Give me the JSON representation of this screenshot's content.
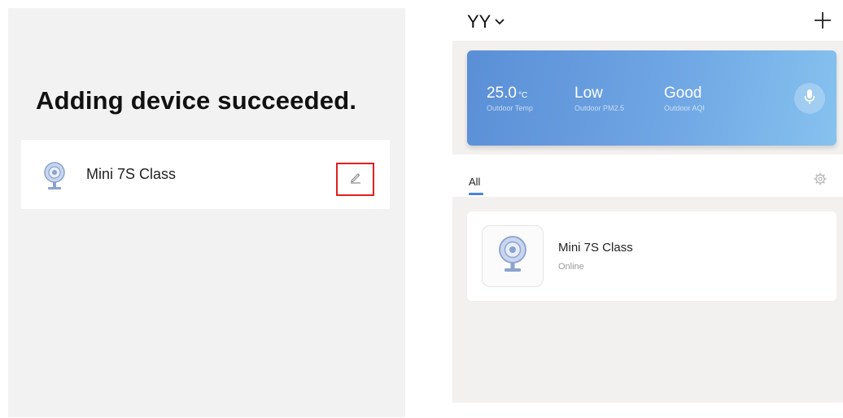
{
  "left_screen": {
    "title": "Adding device succeeded.",
    "device": {
      "name": "Mini 7S Class",
      "icon": "camera-icon"
    },
    "edit_icon": "pencil-icon",
    "highlight_color": "#e02020"
  },
  "right_screen": {
    "home_name": "YY",
    "add_icon": "plus-icon",
    "weather": {
      "temp_value": "25.0",
      "temp_unit": "°C",
      "temp_label": "Outdoor Temp",
      "pm_value": "Low",
      "pm_label": "Outdoor PM2.5",
      "aqi_value": "Good",
      "aqi_label": "Outdoor AQI",
      "mic_icon": "microphone-icon",
      "banner_color": "#5a8fd6"
    },
    "tabs": [
      {
        "label": "All",
        "active": true
      }
    ],
    "settings_icon": "gear-icon",
    "devices": [
      {
        "name": "Mini 7S Class",
        "status": "Online",
        "icon": "camera-icon"
      }
    ],
    "accent_color": "#4a84d6"
  }
}
